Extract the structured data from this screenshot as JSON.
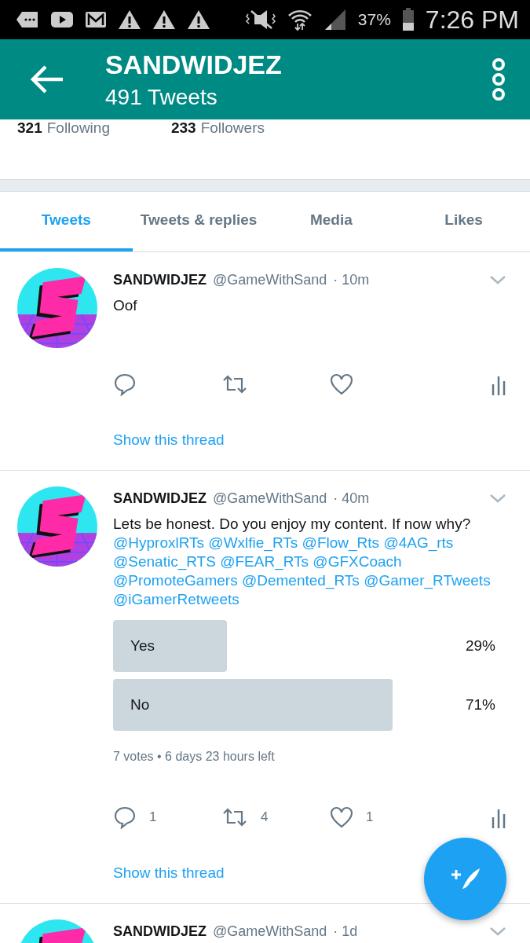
{
  "status_bar": {
    "battery": "37%",
    "time": "7:26 PM"
  },
  "header": {
    "title": "SANDWIDJEZ",
    "subtitle": "491 Tweets"
  },
  "stats": [
    {
      "count": "321",
      "label": "Following"
    },
    {
      "count": "233",
      "label": "Followers"
    }
  ],
  "tabs": [
    {
      "label": "Tweets",
      "selected": true
    },
    {
      "label": "Tweets & replies",
      "selected": false
    },
    {
      "label": "Media",
      "selected": false
    },
    {
      "label": "Likes",
      "selected": false
    }
  ],
  "tweets": [
    {
      "name": "SANDWIDJEZ",
      "handle": "@GameWithSand",
      "time": "· 10m",
      "text": "Oof",
      "actions": [
        {
          "kind": "reply"
        },
        {
          "kind": "retweet"
        },
        {
          "kind": "like"
        },
        {
          "kind": "stats"
        }
      ],
      "show_thread": "Show this thread"
    },
    {
      "name": "SANDWIDJEZ",
      "handle": "@GameWithSand",
      "time": "· 40m",
      "text": "Lets be honest. Do you enjoy my content. If now why?",
      "mentions": [
        "@HyproxlRTs",
        "@Wxlfie_RTs",
        "@Flow_Rts",
        "@4AG_rts",
        "@Senatic_RTS",
        "@FEAR_RTs",
        "@GFXCoach",
        "@PromoteGamers",
        "@Demented_RTs",
        "@Gamer_RTweets",
        "@iGamerRetweets"
      ],
      "poll": {
        "options": [
          {
            "label": "Yes",
            "percent": "29%"
          },
          {
            "label": "No",
            "percent": "71%"
          }
        ],
        "footer": "7 votes • 6 days 23 hours left"
      },
      "actions": [
        {
          "kind": "reply",
          "count": "1"
        },
        {
          "kind": "retweet",
          "count": "4"
        },
        {
          "kind": "like",
          "count": "1"
        },
        {
          "kind": "stats"
        }
      ],
      "show_thread": "Show this thread"
    },
    {
      "name": "SANDWIDJEZ",
      "handle": "@GameWithSand",
      "time": "· 1d"
    }
  ]
}
